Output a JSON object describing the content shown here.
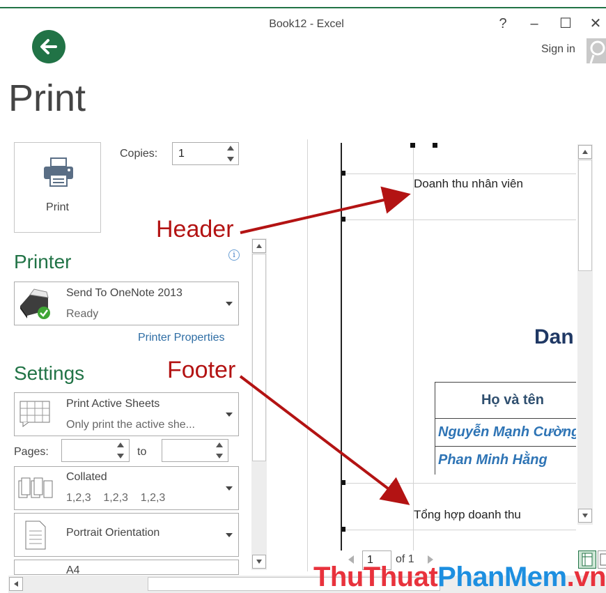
{
  "window": {
    "title": "Book12 - Excel",
    "help": "?",
    "minimize": "–",
    "maximize": "☐",
    "close": "✕",
    "sign_in": "Sign in"
  },
  "backstage": {
    "heading": "Print",
    "print_button": "Print",
    "copies_label": "Copies:",
    "copies_value": "1"
  },
  "printer": {
    "section": "Printer",
    "name": "Send To OneNote 2013",
    "status": "Ready",
    "properties_link": "Printer Properties"
  },
  "settings": {
    "section": "Settings",
    "active_sheets": {
      "title": "Print Active Sheets",
      "subtitle": "Only print the active she..."
    },
    "pages_label": "Pages:",
    "to_label": "to",
    "collated": {
      "title": "Collated",
      "subtitle": "1,2,3    1,2,3    1,2,3"
    },
    "orientation": {
      "title": "Portrait Orientation"
    },
    "paper": {
      "title": "A4"
    }
  },
  "preview": {
    "header_text": "Doanh thu nhân viên",
    "title_fragment": "Dan",
    "table_header": "Họ và tên",
    "rows": [
      "Nguyễn  Mạnh Cường",
      "Phan  Minh Hằng"
    ],
    "footer_text": "Tổng hợp doanh thu",
    "page_current": "1",
    "page_of": "of 1"
  },
  "annotations": {
    "header_label": "Header",
    "footer_label": "Footer"
  },
  "watermark": {
    "part1": "ThuThuat",
    "part2": "PhanMem",
    "part3": ".vn"
  },
  "colors": {
    "excel_green": "#217346",
    "annotation_red": "#b31313",
    "link_blue": "#2e6da4",
    "cell_blue": "#2e74b5",
    "title_navy": "#1f3864"
  }
}
